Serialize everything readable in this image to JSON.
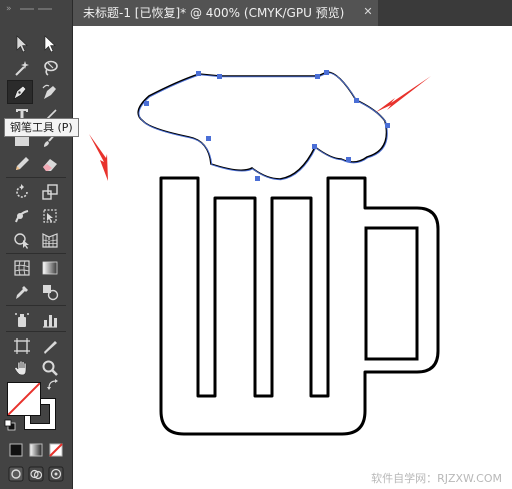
{
  "document": {
    "tab_title": "未标题-1 [已恢复]* @ 400% (CMYK/GPU 预览)",
    "close_glyph": "✕"
  },
  "tooltip": {
    "text": "钢笔工具 (P)"
  },
  "toolbar": {
    "tools": [
      {
        "name": "selection-tool-icon"
      },
      {
        "name": "direct-selection-tool-icon"
      },
      {
        "name": "magic-wand-tool-icon"
      },
      {
        "name": "lasso-tool-icon"
      },
      {
        "name": "pen-tool-icon",
        "active": true
      },
      {
        "name": "curvature-tool-icon"
      },
      {
        "name": "type-tool-icon"
      },
      {
        "name": "line-segment-tool-icon"
      },
      {
        "name": "rectangle-tool-icon"
      },
      {
        "name": "paintbrush-tool-icon"
      },
      {
        "name": "pencil-tool-icon"
      },
      {
        "name": "eraser-tool-icon"
      },
      {
        "name": "rotate-tool-icon"
      },
      {
        "name": "scale-tool-icon"
      },
      {
        "name": "warp-tool-icon"
      },
      {
        "name": "free-transform-tool-icon"
      },
      {
        "name": "shape-builder-tool-icon"
      },
      {
        "name": "perspective-grid-tool-icon"
      },
      {
        "name": "mesh-tool-icon"
      },
      {
        "name": "gradient-tool-icon"
      },
      {
        "name": "eyedropper-tool-icon"
      },
      {
        "name": "blend-tool-icon"
      },
      {
        "name": "symbol-sprayer-tool-icon"
      },
      {
        "name": "column-graph-tool-icon"
      },
      {
        "name": "artboard-tool-icon"
      },
      {
        "name": "slice-tool-icon"
      },
      {
        "name": "hand-tool-icon"
      },
      {
        "name": "zoom-tool-icon"
      }
    ]
  },
  "watermark": {
    "text": "软件自学网：RJZXW.COM"
  },
  "colors": {
    "panel_bg": "#434343",
    "canvas_bg": "#ffffff",
    "path_stroke": "#000000",
    "selection_blue": "#4b6fd6",
    "annotation_red": "#e8322c"
  }
}
